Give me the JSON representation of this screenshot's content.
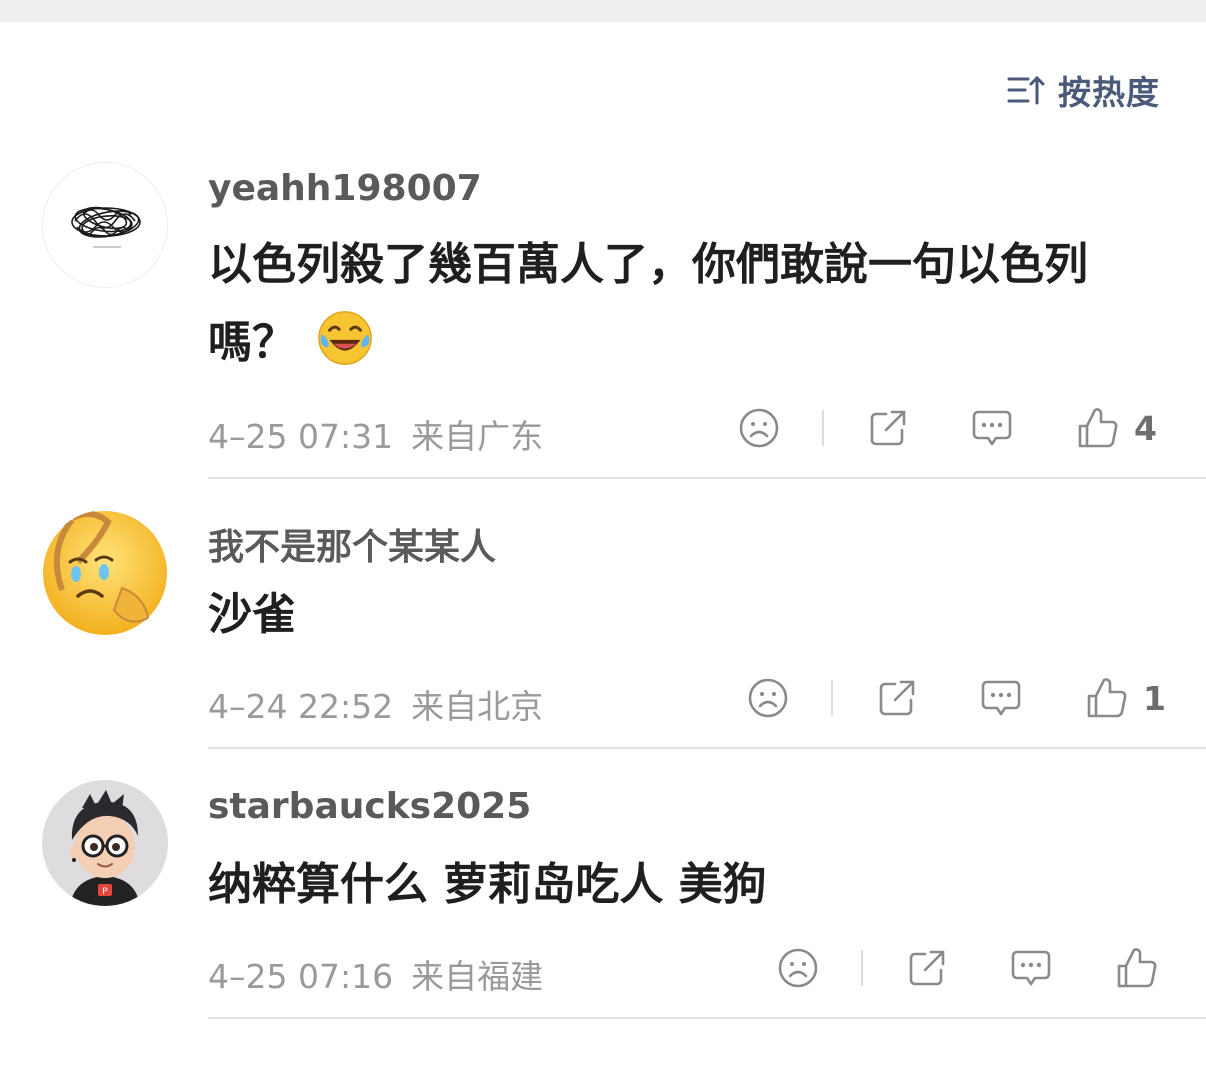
{
  "sort": {
    "label": "按热度",
    "icon": "sort-lines-up-icon"
  },
  "comments": [
    {
      "username": "yeahh198007",
      "text": "以色列殺了幾百萬人了，你們敢說一句以色列嗎？",
      "emoji": "laughing-crying-emoji",
      "time": "4–25 07:31",
      "location": "来自广东",
      "likes": "4"
    },
    {
      "username": "我不是那个某某人",
      "text": "沙雀",
      "time": "4–24 22:52",
      "location": "来自北京",
      "likes": "1"
    },
    {
      "username": "starbaucks2025",
      "text": "纳粹算什么 萝莉岛吃人 美狗",
      "time": "4–25 07:16",
      "location": "来自福建",
      "likes": ""
    }
  ],
  "colors": {
    "text_primary": "#1f1f1f",
    "text_secondary": "#9a9a9a",
    "accent": "#4a5a78",
    "divider": "#e4e4e4"
  }
}
